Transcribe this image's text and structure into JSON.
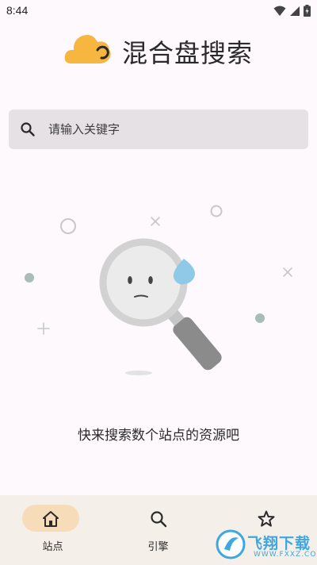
{
  "status_bar": {
    "time": "8:44",
    "icons": [
      "wifi-icon",
      "signal-icon",
      "battery-charging-icon"
    ]
  },
  "header": {
    "title": "混合盘搜索",
    "logo": "cloud-logo-icon"
  },
  "search": {
    "placeholder": "请输入关键字",
    "icon": "search-icon"
  },
  "empty_state": {
    "message": "快来搜索数个站点的资源吧",
    "illustration": "magnifier-sad-face-illustration"
  },
  "bottom_nav": {
    "items": [
      {
        "label": "站点",
        "icon": "home-icon",
        "selected": true
      },
      {
        "label": "引擎",
        "icon": "search-icon",
        "selected": false
      },
      {
        "label": "收藏",
        "icon": "star-icon",
        "selected": false
      }
    ]
  },
  "watermark": {
    "text": "飞翔下载",
    "url": "WWW.FXXZ.COM"
  },
  "colors": {
    "background": "#fdf9fc",
    "search_bg": "#e6e1e5",
    "nav_bg": "#f4efe9",
    "nav_indicator": "#f6dcb9",
    "logo": "#f6b63f",
    "droplet": "#8fc9e8",
    "watermark": "#3ea7e0"
  }
}
